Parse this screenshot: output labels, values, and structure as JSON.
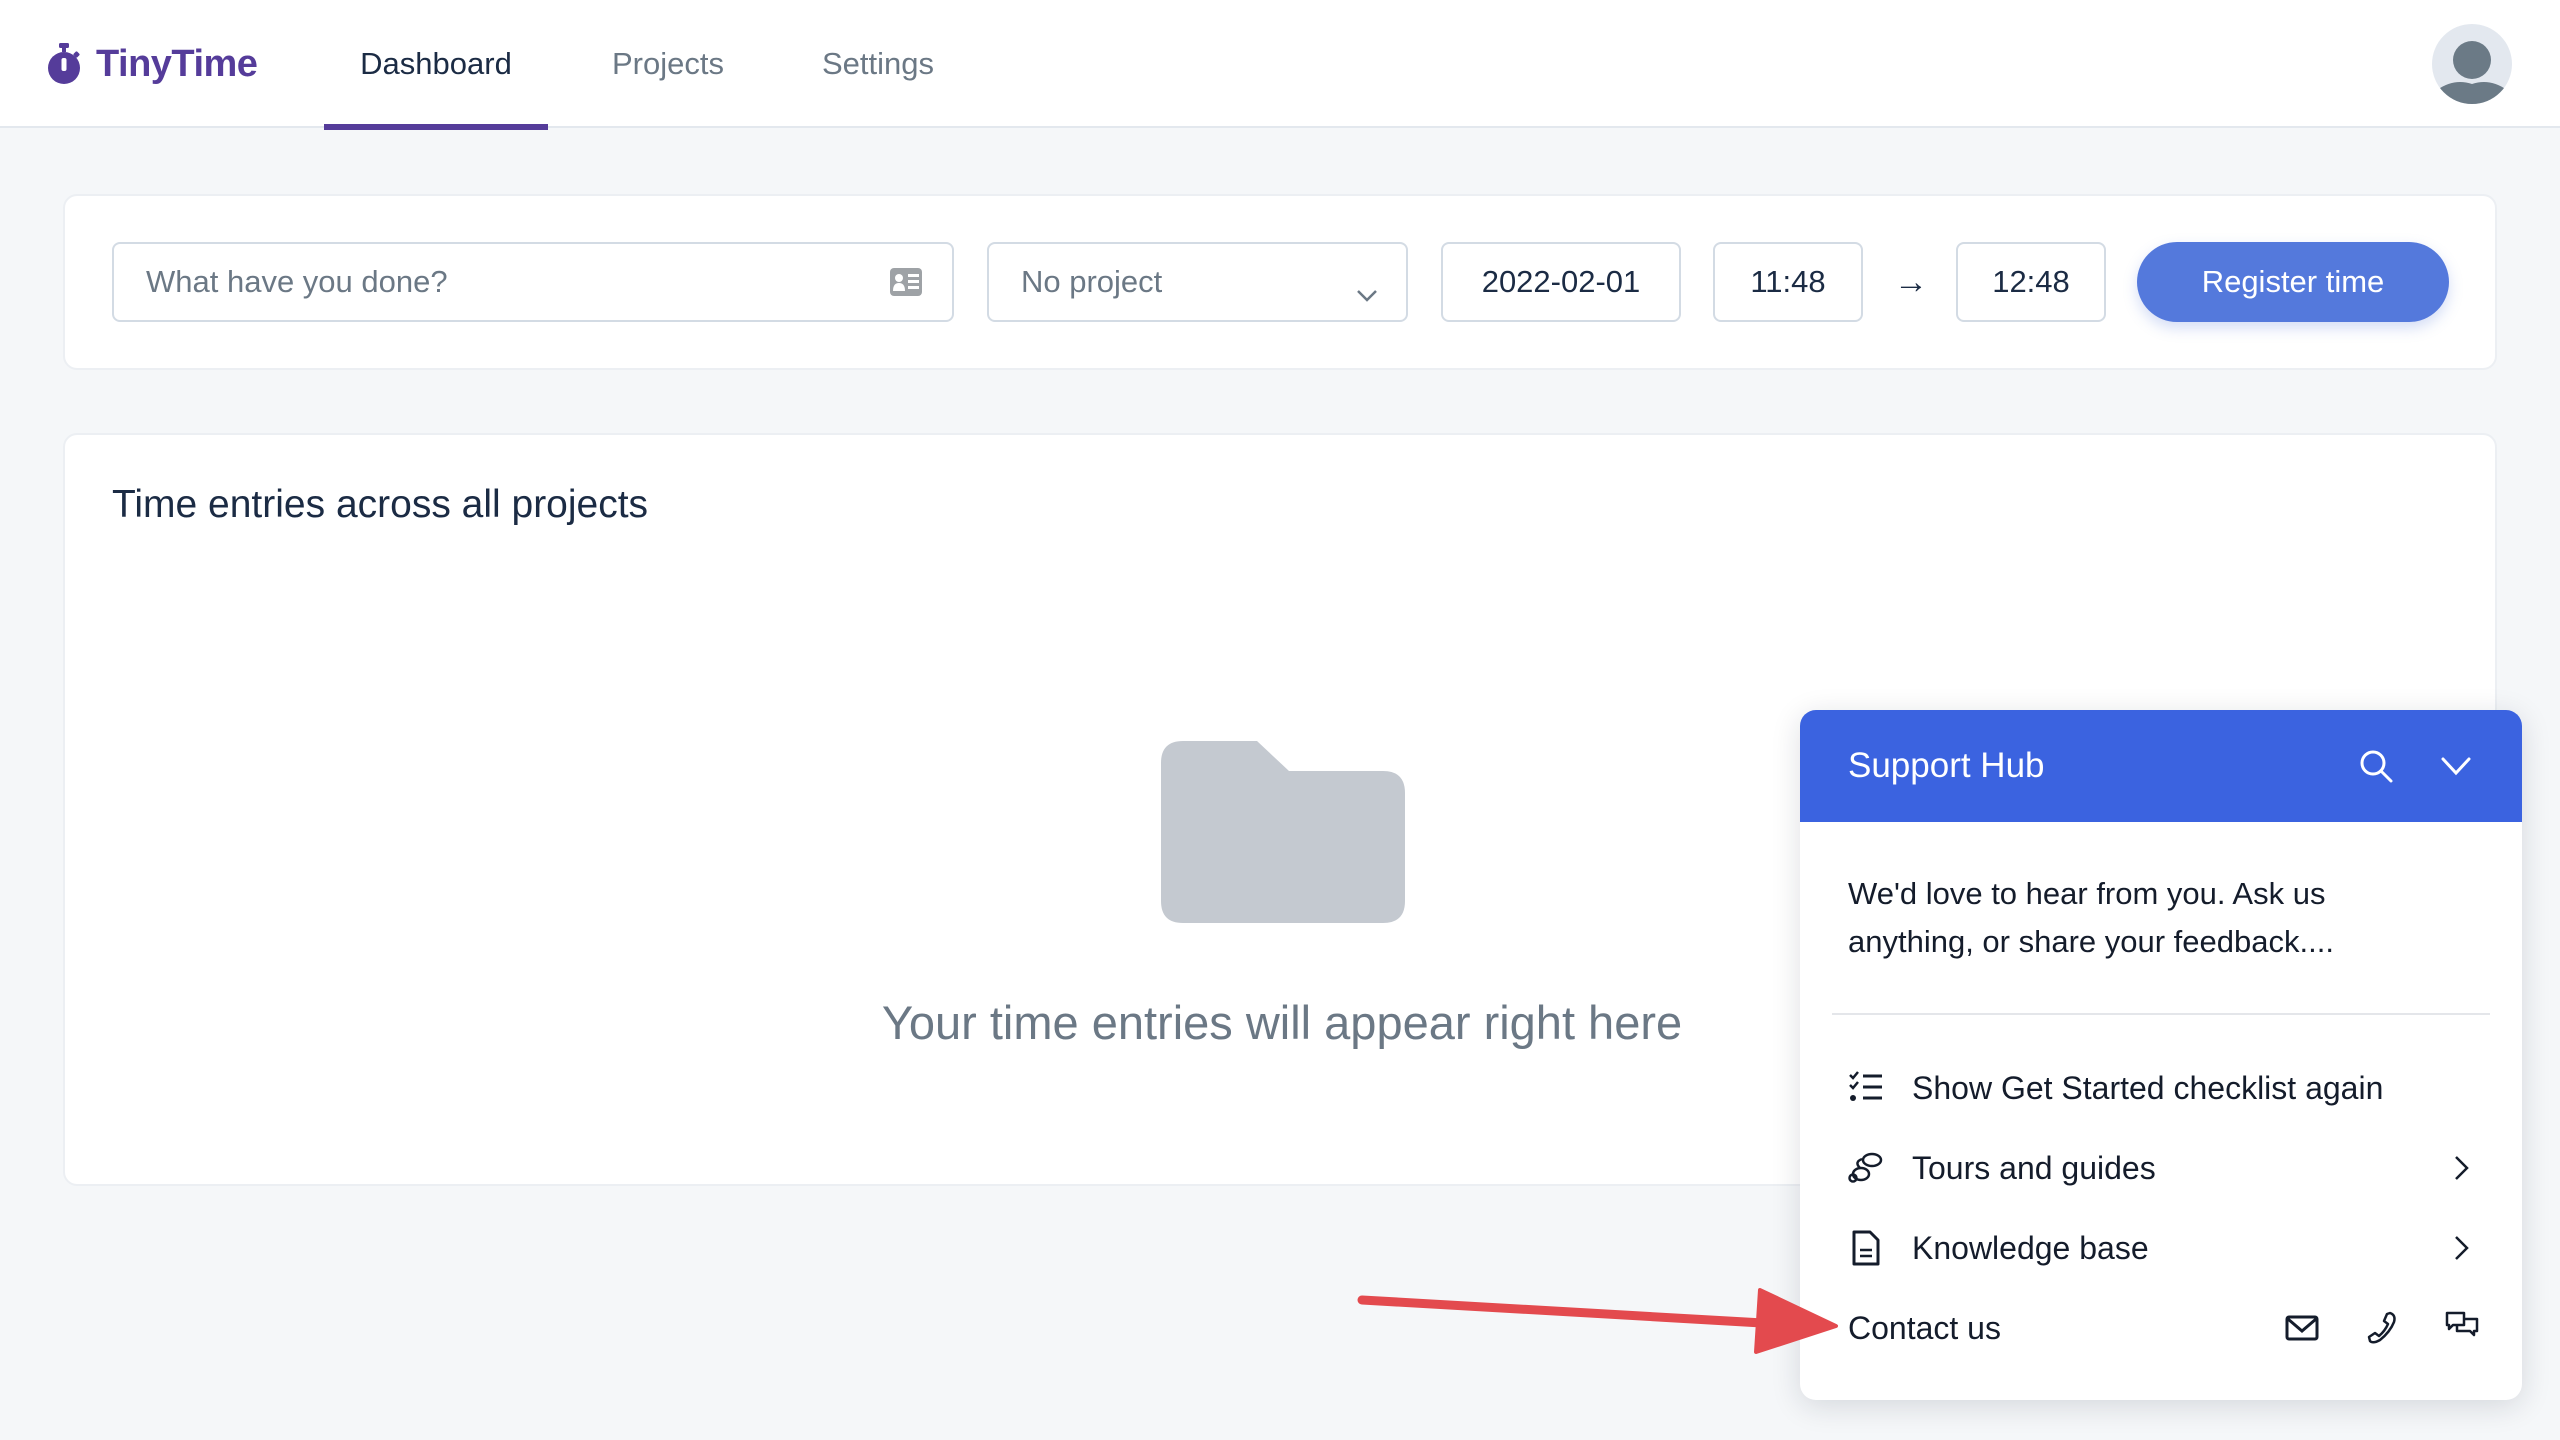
{
  "app": {
    "name": "TinyTime",
    "brand_color": "#553c9a",
    "logo_icon": "stopwatch-icon"
  },
  "nav": {
    "tabs": [
      {
        "label": "Dashboard",
        "active": true
      },
      {
        "label": "Projects",
        "active": false
      },
      {
        "label": "Settings",
        "active": false
      }
    ],
    "avatar_icon": "user-avatar-icon"
  },
  "entry_form": {
    "description": {
      "placeholder": "What have you done?",
      "value": "",
      "icon": "contact-card-icon"
    },
    "project": {
      "selected": "No project",
      "icon": "chevron-down-icon"
    },
    "date": "2022-02-01",
    "start_time": "11:48",
    "arrow": "→",
    "end_time": "12:48",
    "submit_label": "Register time",
    "accent_color": "#5479dc"
  },
  "entries": {
    "title": "Time entries across all projects",
    "empty_icon": "folder-icon",
    "empty_message": "Your time entries will appear right here"
  },
  "support_hub": {
    "title": "Support Hub",
    "header_color": "#3b63e0",
    "header_icons": [
      "search-icon",
      "chevron-down-icon"
    ],
    "message": "We'd love to hear from you. Ask us anything, or share your feedback....",
    "items": [
      {
        "label": "Show Get Started checklist again",
        "icon": "checklist-icon",
        "has_chevron": false
      },
      {
        "label": "Tours and guides",
        "icon": "footsteps-icon",
        "has_chevron": true
      },
      {
        "label": "Knowledge base",
        "icon": "document-icon",
        "has_chevron": true
      },
      {
        "label": "Contact us",
        "icon": null,
        "has_chevron": false,
        "actions": [
          "mail-icon",
          "phone-icon",
          "chat-icon"
        ]
      }
    ]
  },
  "annotation": {
    "type": "arrow",
    "color": "#e34a4e",
    "points_to": "Contact us"
  }
}
